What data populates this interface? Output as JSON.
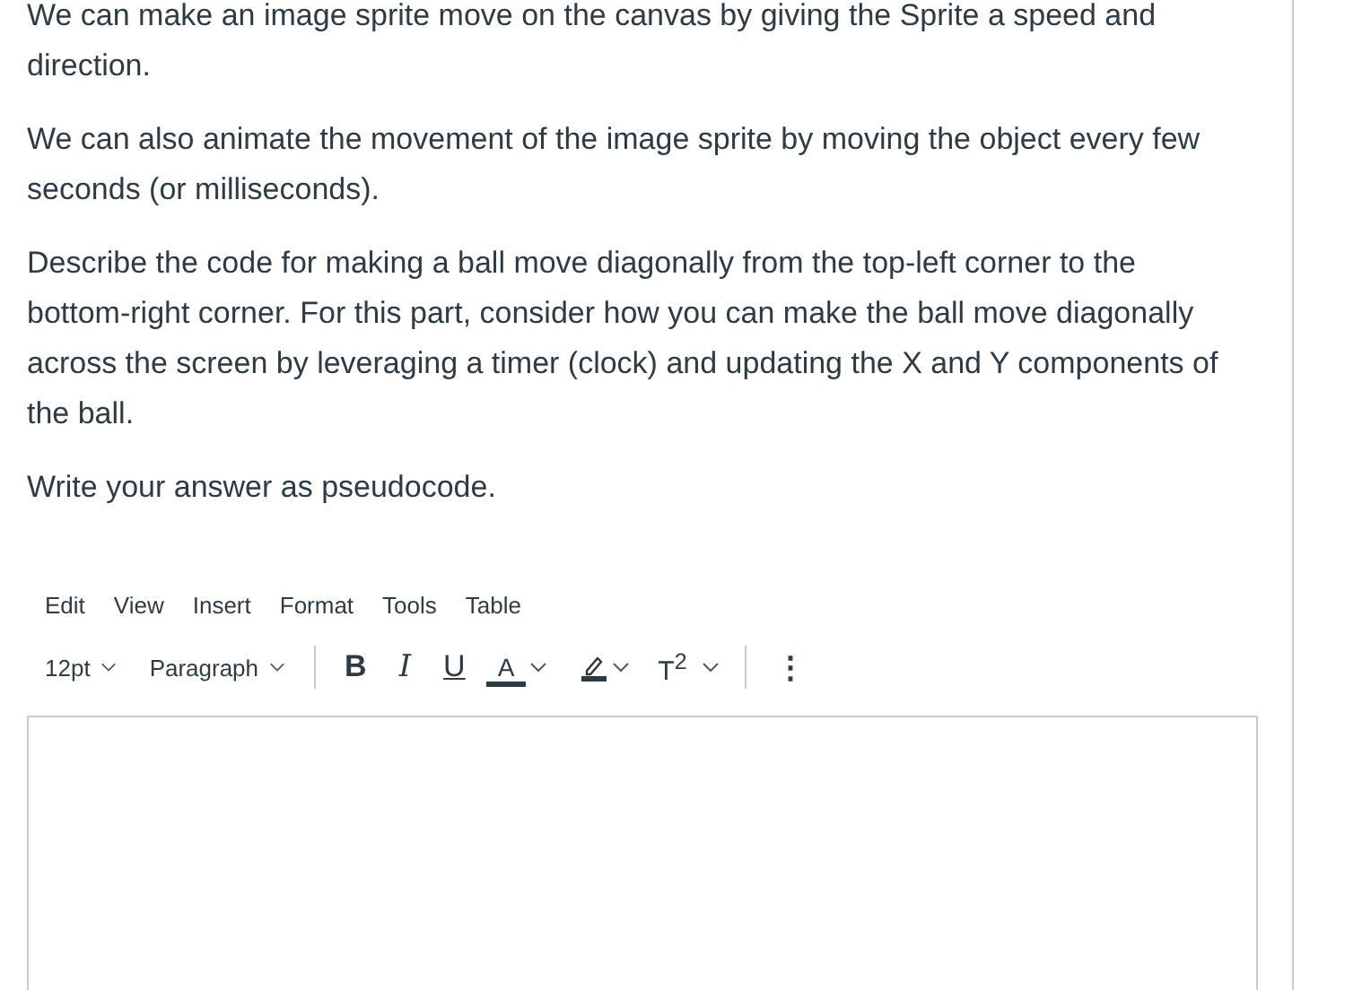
{
  "paragraphs": [
    "We can make an image sprite move on the canvas by giving the Sprite a speed and direction.",
    "We can also animate the movement of the image sprite by moving the object every few seconds (or milliseconds).",
    "Describe the code for making a ball move diagonally from the top-left corner to the bottom-right corner. For this part, consider how you can make the ball move diagonally across the screen by leveraging a timer (clock) and updating the X and Y components of the ball.",
    "Write your answer as pseudocode."
  ],
  "editor": {
    "menu": [
      "Edit",
      "View",
      "Insert",
      "Format",
      "Tools",
      "Table"
    ],
    "font_size": "12pt",
    "block_format": "Paragraph",
    "tools": [
      {
        "kind": "bold",
        "label": "B"
      },
      {
        "kind": "italic",
        "label": "I"
      },
      {
        "kind": "underline",
        "label": "U"
      },
      {
        "kind": "text-color",
        "label": "A"
      },
      {
        "kind": "highlight"
      },
      {
        "kind": "superscript",
        "label": "T$^{2}$"
      },
      {
        "kind": "more",
        "label": "⋮"
      }
    ]
  }
}
